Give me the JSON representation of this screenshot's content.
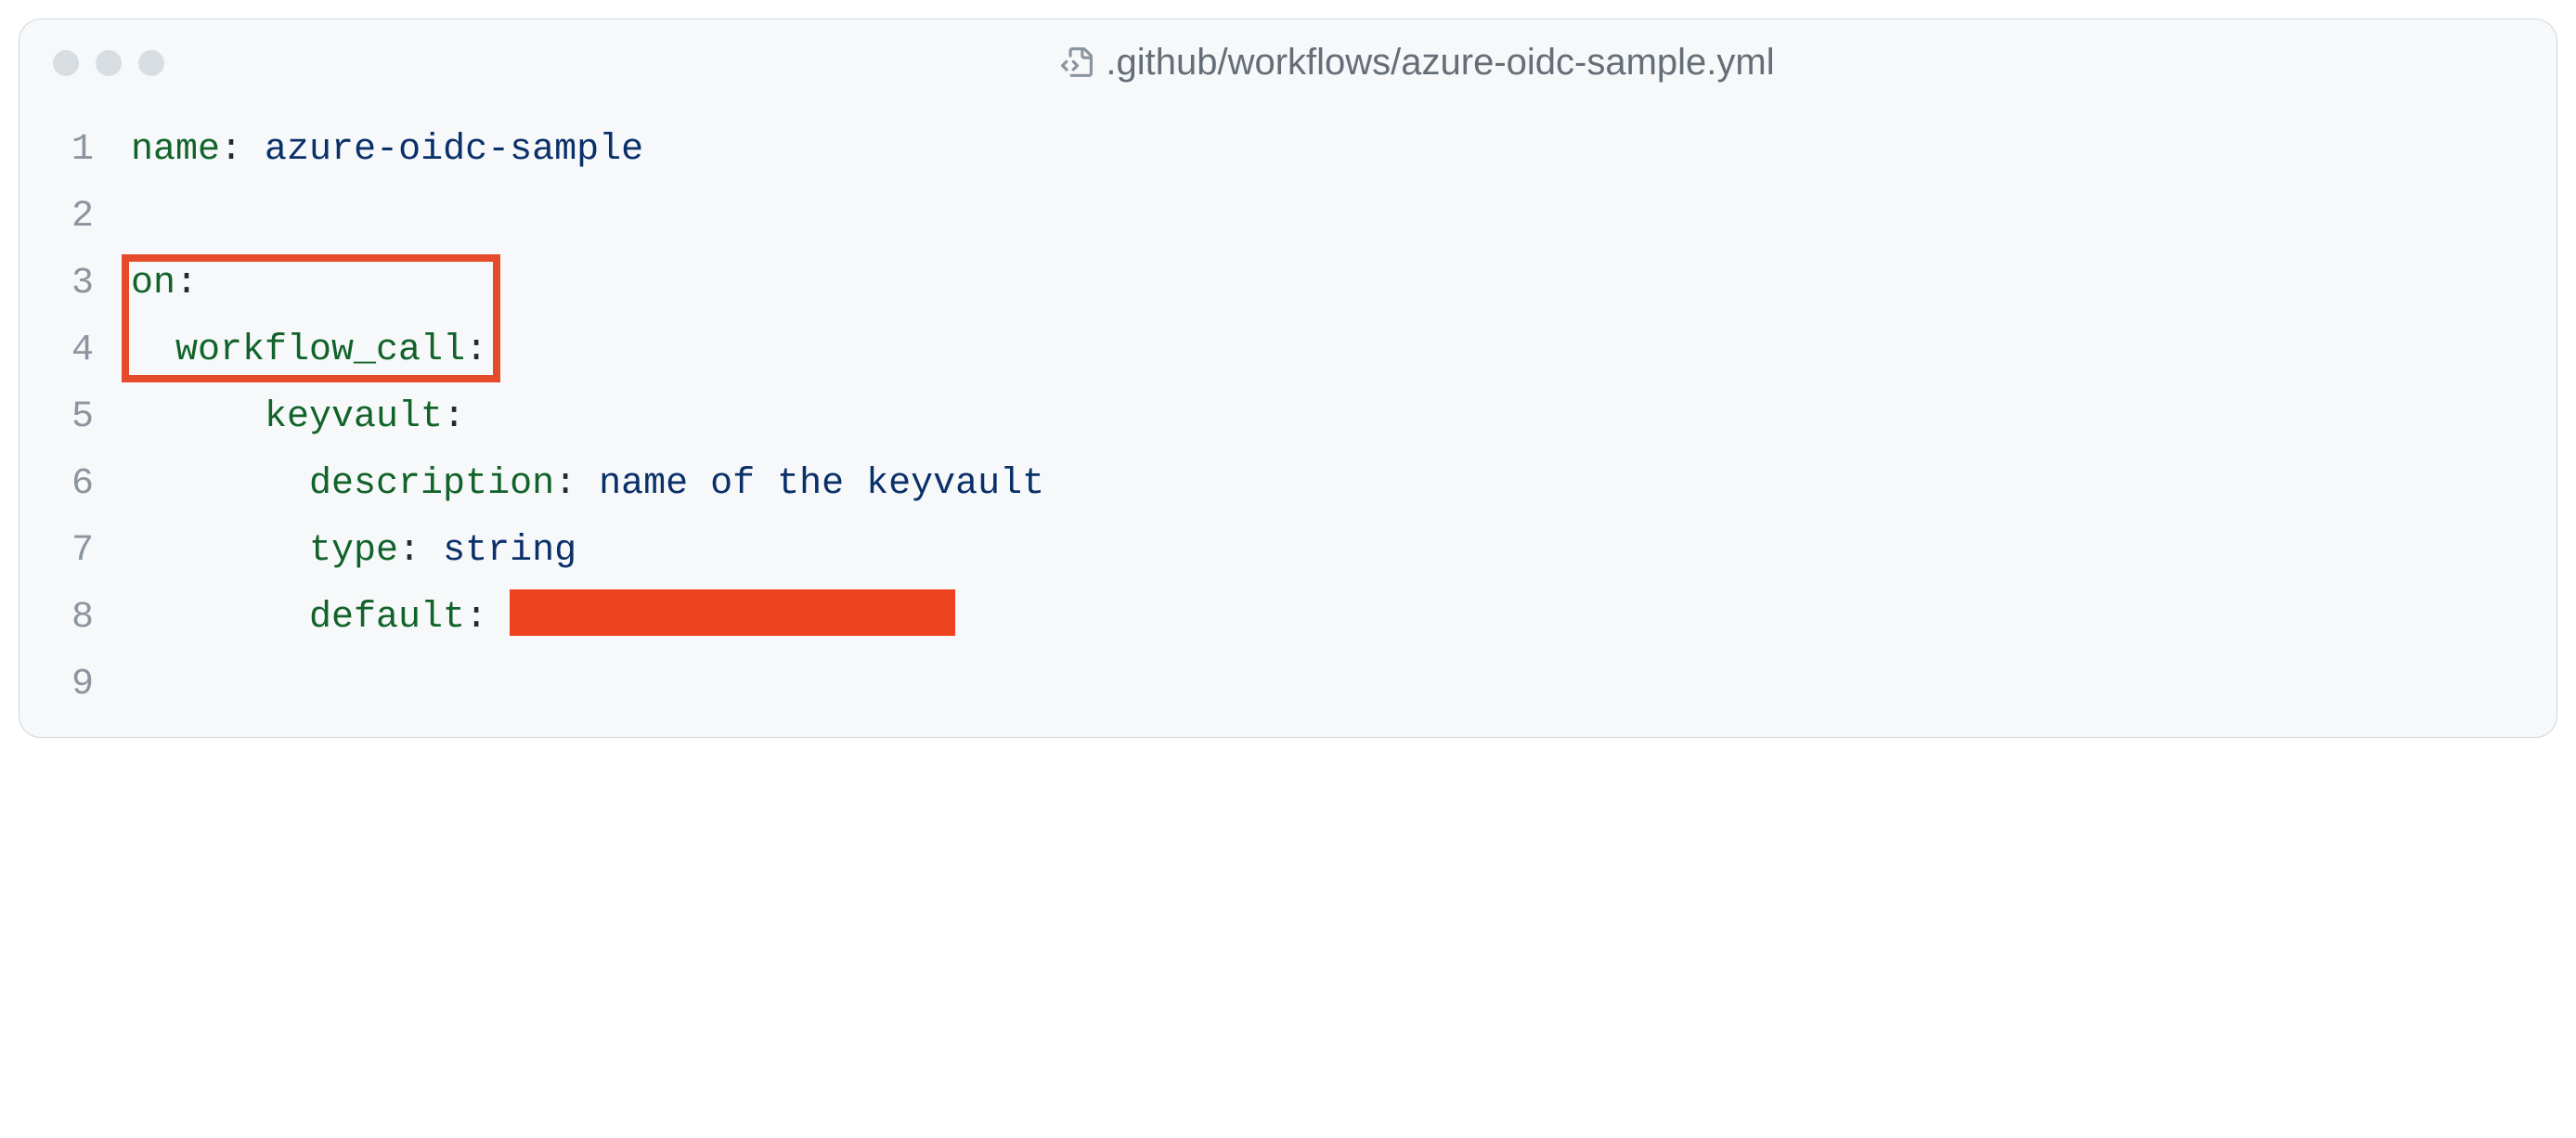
{
  "header": {
    "file_path": ".github/workflows/azure-oidc-sample.yml"
  },
  "code": {
    "lines": [
      {
        "num": "1",
        "segments": [
          {
            "cls": "tok-key",
            "t": "name"
          },
          {
            "cls": "tok-punct",
            "t": ":"
          },
          {
            "cls": "",
            "t": " "
          },
          {
            "cls": "tok-str",
            "t": "azure-oidc-sample"
          }
        ],
        "indent": 0
      },
      {
        "num": "2",
        "segments": [],
        "indent": 0
      },
      {
        "num": "3",
        "segments": [
          {
            "cls": "tok-key",
            "t": "on"
          },
          {
            "cls": "tok-punct",
            "t": ":"
          }
        ],
        "indent": 0
      },
      {
        "num": "4",
        "segments": [
          {
            "cls": "tok-key",
            "t": "workflow_call"
          },
          {
            "cls": "tok-punct",
            "t": ":"
          }
        ],
        "indent": 2
      },
      {
        "num": "5",
        "segments": [
          {
            "cls": "tok-key",
            "t": "keyvault"
          },
          {
            "cls": "tok-punct",
            "t": ":"
          }
        ],
        "indent": 6
      },
      {
        "num": "6",
        "segments": [
          {
            "cls": "tok-key",
            "t": "description"
          },
          {
            "cls": "tok-punct",
            "t": ":"
          },
          {
            "cls": "",
            "t": " "
          },
          {
            "cls": "tok-str",
            "t": "name of the keyvault"
          }
        ],
        "indent": 8
      },
      {
        "num": "7",
        "segments": [
          {
            "cls": "tok-key",
            "t": "type"
          },
          {
            "cls": "tok-punct",
            "t": ":"
          },
          {
            "cls": "",
            "t": " "
          },
          {
            "cls": "tok-str",
            "t": "string"
          }
        ],
        "indent": 8
      },
      {
        "num": "8",
        "segments": [
          {
            "cls": "tok-key",
            "t": "default"
          },
          {
            "cls": "tok-punct",
            "t": ":"
          },
          {
            "cls": "",
            "t": " "
          },
          {
            "cls": "redact",
            "t": ""
          }
        ],
        "indent": 8
      },
      {
        "num": "9",
        "segments": [],
        "indent": 0
      }
    ]
  },
  "annotations": {
    "highlight": {
      "top_line": 3,
      "bot_line": 4
    }
  }
}
